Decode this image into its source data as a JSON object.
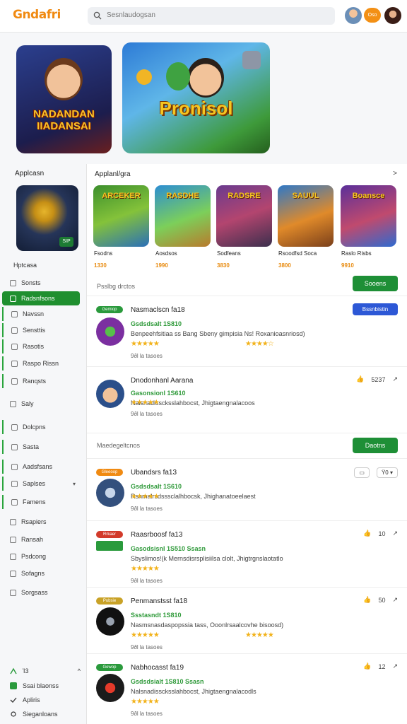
{
  "header": {
    "logo": "Gndafri",
    "search_placeholder": "Sesnlaudogsan",
    "pill_label": "Oso"
  },
  "hero": {
    "left_title_line1": "NADANDAN",
    "left_title_line2": "IIADANSAI",
    "right_title": "Pronisol"
  },
  "sidebar": {
    "title": "Applcasn",
    "card_badge": "SIP",
    "section_label": "Hptcasa",
    "items": [
      {
        "label": "Sonsts"
      },
      {
        "label": "Radsnfsons"
      },
      {
        "label": "Navssn"
      },
      {
        "label": "Sensttis"
      },
      {
        "label": "Rasotis"
      },
      {
        "label": "Raspo Rissn"
      },
      {
        "label": "Ranqsts"
      },
      {
        "label": "Saly"
      },
      {
        "label": "Dolcpns"
      },
      {
        "label": "Sasta"
      },
      {
        "label": "Aadsfsans"
      },
      {
        "label": "Saplses"
      },
      {
        "label": "Famens"
      },
      {
        "label": "Rsapiers"
      },
      {
        "label": "Ransah"
      },
      {
        "label": "Psdcong"
      },
      {
        "label": "Sofagns"
      },
      {
        "label": "Sorgsass"
      }
    ],
    "footer": [
      {
        "label": "Ί3"
      },
      {
        "label": "Ssai blaonss"
      },
      {
        "label": "Apliris"
      },
      {
        "label": "Sieganloans"
      }
    ]
  },
  "main": {
    "title": "Applanl/gra",
    "chevron": ">",
    "tiles": [
      {
        "title": "ARCEKER",
        "name": "Fsodns",
        "price": "1330"
      },
      {
        "title": "RASDHE",
        "name": "Aosdsos",
        "price": "1990"
      },
      {
        "title": "RADSRE",
        "name": "Sodfeans",
        "price": "3830"
      },
      {
        "title": "SAUUL",
        "name": "Rsoodfsd Soca",
        "price": "3800"
      },
      {
        "title": "Boansce",
        "name": "Raslo Risbs",
        "price": "9910"
      }
    ],
    "section1": {
      "label": "Psslbg drctos",
      "button": "Sooens"
    },
    "section2": {
      "label": "Maedegeltcnos",
      "button": "Daotns"
    },
    "entries": [
      {
        "tag": "Gemiop",
        "name": "Nasmaclscn fa18",
        "meta": "Gsdsdsalt 1S810",
        "desc": "Benpeehfsitiaa ss Bang Sbeny gimpisia Ns! Roxanioasnriosd)",
        "stars": "★★★★★",
        "stars2": "★★★★☆",
        "reviews": "9ðl la tasoes",
        "action": "Bssnbistin"
      },
      {
        "tag": "",
        "name": "Dnodonhanl Aarana",
        "meta": "Gasonsionl 1S610",
        "desc": "Nalsnadisscksslahbocst, Jhigtaengnalacoos",
        "stars": "★★★★★",
        "stars2": "",
        "reviews": "9ðl la tasoes",
        "action": "5237"
      },
      {
        "tag": "Gleeoop",
        "name": "Ubandsrs fa13",
        "meta": "Gsdsdsalt 1S610",
        "desc": "Rsnmalrsdsssclalhbocsk, Jhighanatoeelaest",
        "stars": "★★★★★",
        "stars2": "",
        "reviews": "9ðl la tasoes",
        "action": "Ϋ0"
      },
      {
        "tag": "Rrkaer",
        "name": "Raasrboosf fa13",
        "meta": "Gasodsisnl 1S510 Ssasn",
        "desc": "Sbyslimos!(k Mernsdisrsplisiilsa clolt, Jhigtrgnslaotatlo",
        "stars": "★★★★★",
        "stars2": "",
        "reviews": "9ðl la tasoes",
        "action": "10"
      },
      {
        "tag": "Pubsie",
        "name": "Penmanstsst fa18",
        "meta": "Ssstasndt 1S810",
        "desc": "Nasmsnasdaspopssia tass, Ooonlrsaalcovhe bisoosd)",
        "stars": "★★★★★",
        "stars2": "★★★★★",
        "reviews": "9ðl la tasoes",
        "action": "50"
      },
      {
        "tag": "Gewop",
        "name": "Nabhocasst fa19",
        "meta": "Gsdsdsialt 1S810 Ssasn",
        "desc": "Nalsnadisscksslahbocst, Jhigtaengnalacodls",
        "stars": "★★★★★",
        "stars2": "",
        "reviews": "9ðl la tasoes",
        "action": "12"
      }
    ]
  }
}
